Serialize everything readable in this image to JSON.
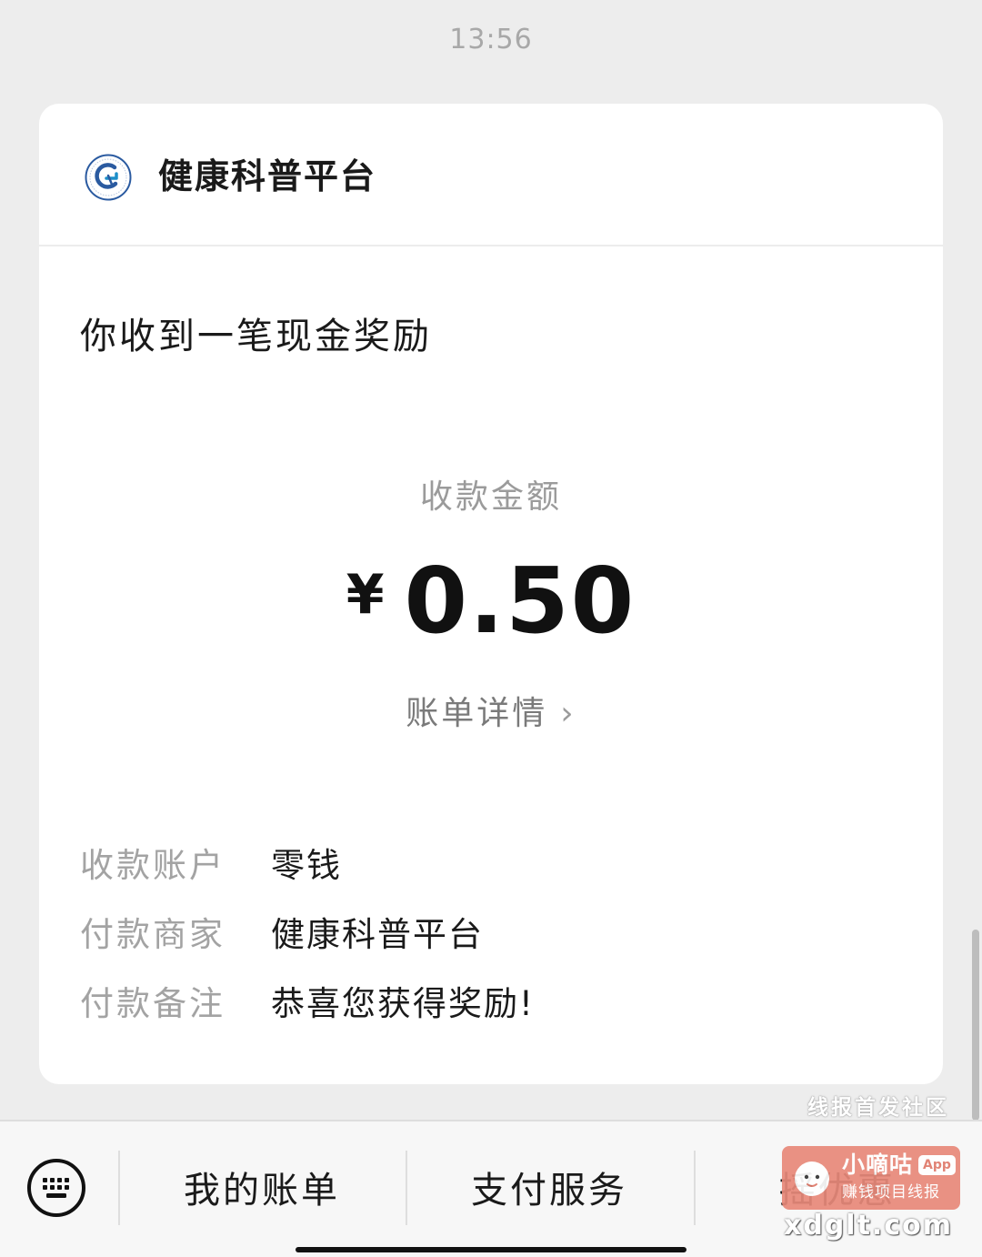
{
  "timestamp": "13:56",
  "card": {
    "service_name": "健康科普平台",
    "logo_icon": "health-platform-logo-icon",
    "notice_title": "你收到一笔现金奖励",
    "amount_label": "收款金额",
    "currency_symbol": "¥",
    "amount": "0.50",
    "detail_link": "账单详情",
    "detail_chevron": "›",
    "info": [
      {
        "label": "收款账户",
        "value": "零钱"
      },
      {
        "label": "付款商家",
        "value": "健康科普平台"
      },
      {
        "label": "付款备注",
        "value": "恭喜您获得奖励!"
      }
    ]
  },
  "bottom_bar": {
    "keyboard_icon": "keyboard-icon",
    "menu": [
      "我的账单",
      "支付服务",
      "摇优惠"
    ]
  },
  "watermark": {
    "caption": "线报首发社区",
    "brand": "小嘀咕",
    "app_tag": "App",
    "slogan": "赚钱项目线报",
    "url": "xdglt.com"
  },
  "colors": {
    "page_background": "#ededed",
    "card_background": "#ffffff",
    "secondary_text": "#9b9b9b",
    "primary_text": "#1a1a1a",
    "logo_blue": "#2a5aa0",
    "watermark_badge": "#e8897a"
  }
}
